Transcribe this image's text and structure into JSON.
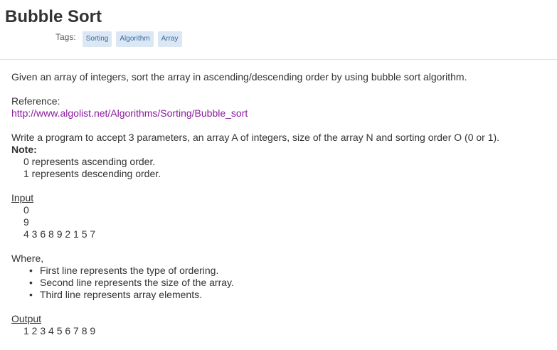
{
  "header": {
    "title": "Bubble Sort",
    "tags_label": "Tags:",
    "tags": [
      "Sorting",
      "Algorithm",
      "Array"
    ]
  },
  "problem": {
    "intro": "Given an array of integers, sort the array in ascending/descending order by using bubble sort algorithm.",
    "reference_label": "Reference:",
    "reference_url": "http://www.algolist.net/Algorithms/Sorting/Bubble_sort",
    "task": "Write a program to accept 3 parameters, an array A of integers, size of the array N and sorting order O (0 or 1).",
    "note_label": "Note:",
    "notes": [
      "0 represents ascending order.",
      "1 represents descending order."
    ],
    "input_label": "Input",
    "input_lines": [
      "0",
      "9",
      "4 3 6 8 9 2 1 5 7"
    ],
    "where_label": "Where,",
    "where_items": [
      "First line represents the type of ordering.",
      "Second line represents the size of the array.",
      "Third line represents array elements."
    ],
    "output_label": "Output",
    "output_lines": [
      "1 2 3 4 5 6 7 8 9"
    ]
  }
}
